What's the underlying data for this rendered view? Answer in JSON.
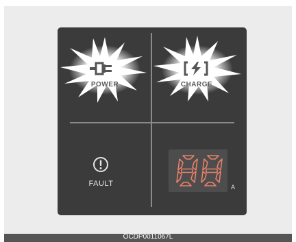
{
  "panel": {
    "power": {
      "label": "POWER",
      "icon": "plug-icon",
      "state": "lit"
    },
    "charge": {
      "label": "CHARGE",
      "icon": "battery-bolt-icon",
      "state": "lit"
    },
    "fault": {
      "label": "FAULT",
      "icon": "exclamation-circle-icon",
      "state": "off"
    },
    "current_display": {
      "digits": "88",
      "unit": "A",
      "digit_color": "#e8806a"
    }
  },
  "caption": "OCDP0011067L",
  "colors": {
    "panel": "#3b3b3b",
    "glow": "#ffffff",
    "divider": "#8a8a8a"
  }
}
